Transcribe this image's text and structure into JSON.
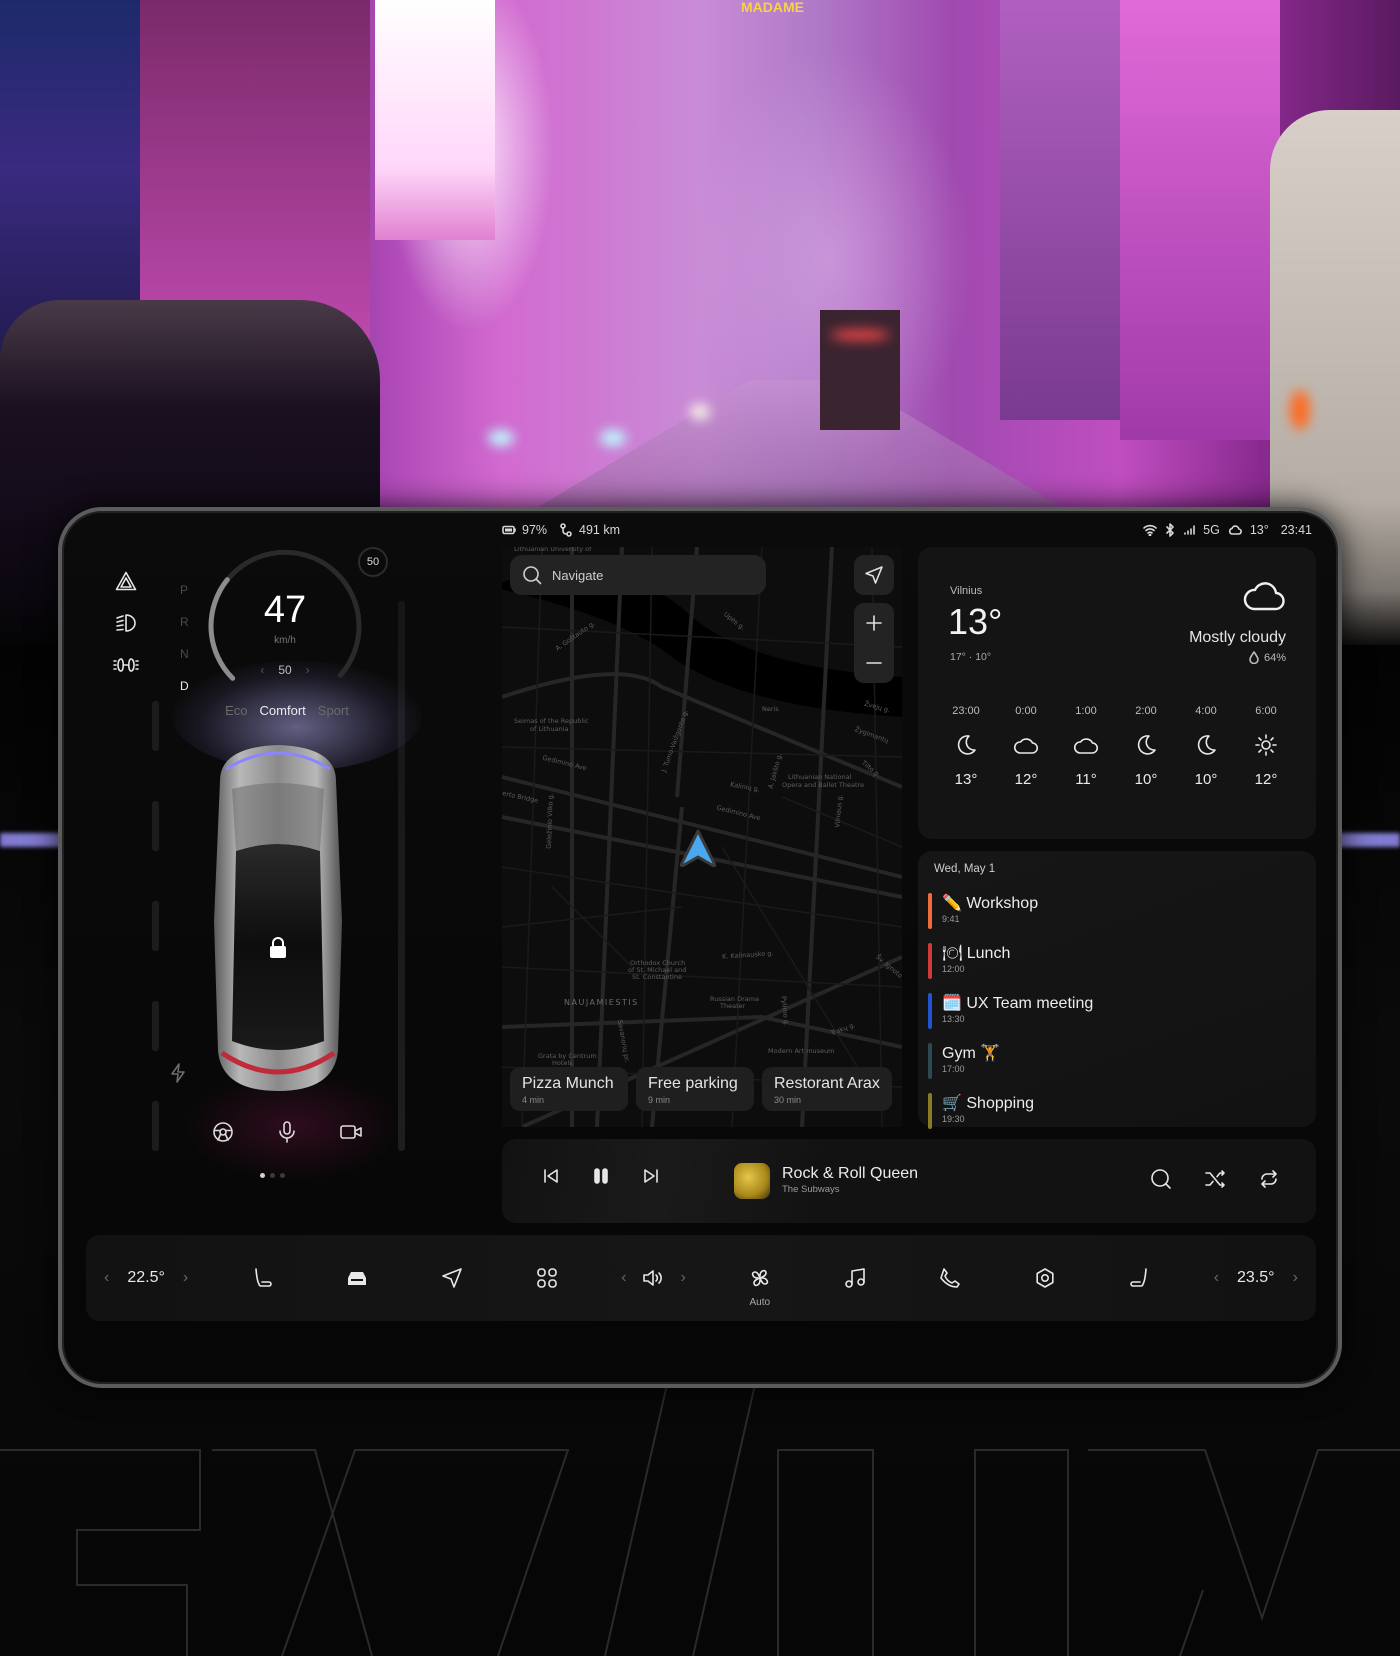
{
  "background": {
    "sign_text": "MADAME",
    "wordmark": "EV/UX"
  },
  "status_bar": {
    "battery": "97%",
    "range": "491 km",
    "network": "5G",
    "outside_temp": "13°",
    "time": "23:41",
    "icons": [
      "battery-icon",
      "range-icon",
      "wifi-icon",
      "bluetooth-icon",
      "signal-icon",
      "cloud-icon"
    ]
  },
  "drive": {
    "quick_controls": [
      "hazard-icon",
      "headlights-icon",
      "parking-lights-icon"
    ],
    "gears": [
      "P",
      "R",
      "N",
      "D"
    ],
    "active_gear": "D",
    "speed": "47",
    "speed_unit": "km/h",
    "speed_fraction_of_gauge": 0.31,
    "cruise_limit": "50",
    "speed_limit_sign": "50",
    "modes": [
      "Eco",
      "Comfort",
      "Sport"
    ],
    "active_mode": "Comfort",
    "car_actions": [
      "steering-wheel-icon",
      "microphone-icon",
      "camera-icon"
    ],
    "pager": {
      "pages": 3,
      "active": 1
    }
  },
  "map": {
    "search_placeholder": "Navigate",
    "labels": {
      "university": "Lithuanian University of",
      "seimas": "Seimas of the Republic",
      "seimas2": "of Lithuania",
      "gediminas1": "Gedimino Ave",
      "gediminas2": "Gedimino Ave",
      "goštauto": "A. Goštauto g.",
      "upes": "Upės g.",
      "vaizganto": "J. Tumo-Vaižganto g.",
      "kalinu": "Kalinių g.",
      "jaksto": "A. Jakšto g.",
      "opera": "Lithuanian National",
      "opera2": "Opera and Ballet Theatre",
      "tilto": "Tilto g.",
      "zygimantu": "Žygimantų",
      "zveju": "Žvejų g.",
      "neris": "Neris",
      "vilniaus": "Vilniaus g.",
      "vilko": "Geležinio Vilko g.",
      "bridge": "erto Bridge",
      "kalinausko": "K. Kalinausko g.",
      "orthodox": "Orthodox Church",
      "orthodox2": "of St. Michael and",
      "orthodox3": "St. Constantine",
      "district": "NAUJAMIESTIS",
      "drama": "Russian Drama",
      "drama2": "Theater",
      "pylimo": "Pylimo g.",
      "modern": "Modern Art museum",
      "traku": "Trakų g.",
      "ignoto": "Šv. Ignoto g.",
      "grata": "Grata by Centrum",
      "grata2": "Hotels",
      "savanoriu": "Savanorių pr."
    },
    "pois": [
      {
        "name": "Pizza Munch",
        "eta": "4 min"
      },
      {
        "name": "Free parking",
        "eta": "9 min"
      },
      {
        "name": "Restorant Arax",
        "eta": "30 min"
      }
    ]
  },
  "weather": {
    "city": "Vilnius",
    "temp": "13°",
    "range": "17° · 10°",
    "condition": "Mostly cloudy",
    "humidity": "64%",
    "hourly": [
      {
        "time": "23:00",
        "icon": "moon",
        "temp": "13°"
      },
      {
        "time": "0:00",
        "icon": "cloud",
        "temp": "12°"
      },
      {
        "time": "1:00",
        "icon": "cloud",
        "temp": "11°"
      },
      {
        "time": "2:00",
        "icon": "moon",
        "temp": "10°"
      },
      {
        "time": "4:00",
        "icon": "moon",
        "temp": "10°"
      },
      {
        "time": "6:00",
        "icon": "sun",
        "temp": "12°"
      }
    ]
  },
  "agenda": {
    "date": "Wed, May 1",
    "events": [
      {
        "title": "✏️ Workshop",
        "time": "9:41",
        "color": "#f26b3a"
      },
      {
        "title": "🍽 Lunch",
        "time": "12:00",
        "color": "#d23a3a"
      },
      {
        "title": "🗓️ UX Team meeting",
        "time": "13:30",
        "color": "#1f55d0"
      },
      {
        "title": "Gym 🏋️",
        "time": "17:00",
        "color": "#2e4a50"
      },
      {
        "title": "🛒 Shopping",
        "time": "19:30",
        "color": "#8a7a22"
      }
    ]
  },
  "player": {
    "track": "Rock & Roll Queen",
    "artist": "The Subways",
    "state": "playing"
  },
  "dock": {
    "driver_temp": "22.5°",
    "passenger_temp": "23.5°",
    "fan_label": "Auto",
    "items": [
      "seat-driver-icon",
      "car-icon",
      "navigation-icon",
      "apps-icon",
      "volume-icon",
      "fan-icon",
      "music-icon",
      "phone-icon",
      "settings-icon",
      "seat-passenger-icon"
    ]
  }
}
